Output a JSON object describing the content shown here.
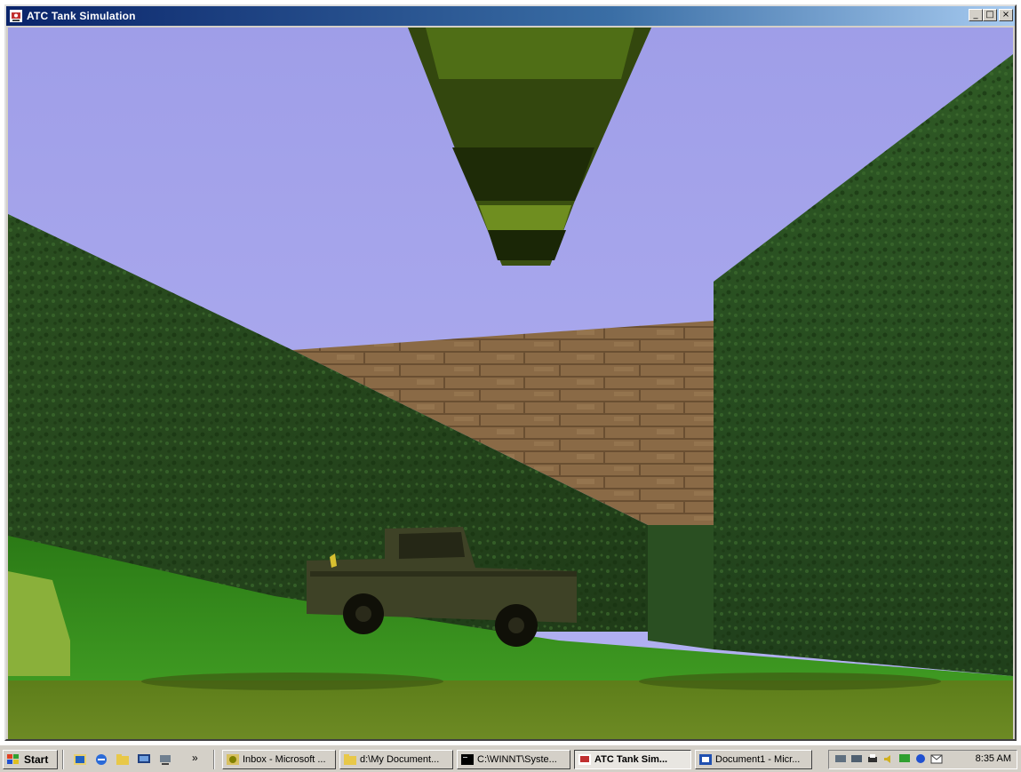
{
  "window": {
    "title": "ATC Tank Simulation",
    "minimize_glyph": "_",
    "maximize_glyph": "□",
    "close_glyph": "×"
  },
  "colors": {
    "title_bar_start": "#0a246a",
    "title_bar_end": "#a6caf0",
    "sky": "#a6a6ee",
    "hedge": "#2f5a25",
    "grass": "#2f8a18",
    "brick": "#8a6a44",
    "truck": "#3b3e24",
    "barrel": "#3d5a12"
  },
  "taskbar": {
    "start_label": "Start",
    "quick_launch": [
      {
        "icon": "outlook-icon"
      },
      {
        "icon": "internet-explorer-icon"
      },
      {
        "icon": "folder-icon"
      },
      {
        "icon": "desktop-icon"
      },
      {
        "icon": "network-icon"
      }
    ],
    "overflow_label": "»",
    "tasks": [
      {
        "label": "Inbox - Microsoft ...",
        "icon": "inbox-icon",
        "active": false
      },
      {
        "label": "d:\\My Document...",
        "icon": "folder-icon",
        "active": false
      },
      {
        "label": "C:\\WINNT\\Syste...",
        "icon": "console-icon",
        "active": false
      },
      {
        "label": "ATC Tank Sim...",
        "icon": "simulation-icon",
        "active": true
      },
      {
        "label": "Document1 - Micr...",
        "icon": "word-icon",
        "active": false
      }
    ],
    "tray_icons": [
      "network-icon",
      "network-icon",
      "printer-icon",
      "volume-icon",
      "monitor-icon",
      "messenger-icon",
      "mail-icon"
    ],
    "clock": "8:35 AM"
  }
}
